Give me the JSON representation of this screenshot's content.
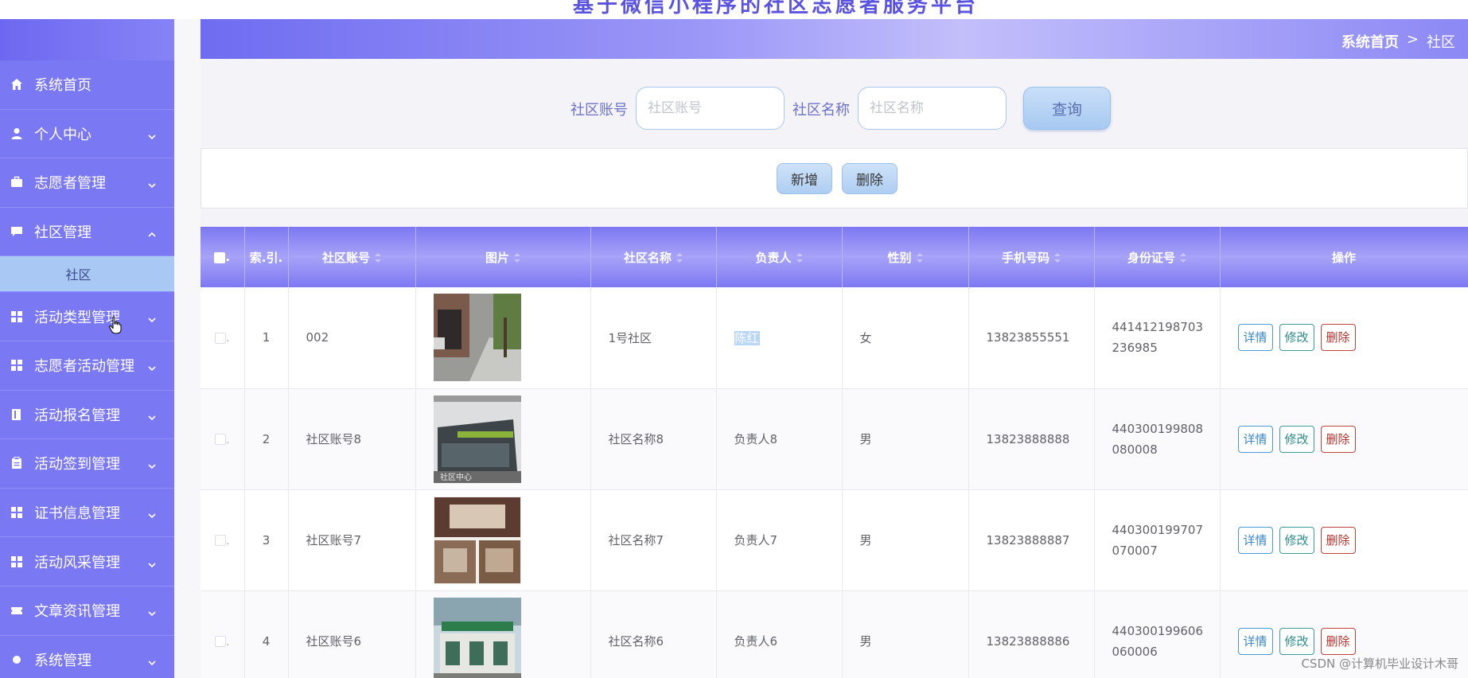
{
  "app": {
    "title": "基于微信小程序的社区志愿者服务平台"
  },
  "breadcrumb": {
    "home": "系统首页",
    "separator": ">",
    "current": "社区"
  },
  "sidebar": {
    "items": [
      {
        "label": "系统首页",
        "icon": "home-icon",
        "expandable": false
      },
      {
        "label": "个人中心",
        "icon": "user-icon",
        "expandable": true
      },
      {
        "label": "志愿者管理",
        "icon": "briefcase-icon",
        "expandable": true
      },
      {
        "label": "社区管理",
        "icon": "chat-icon",
        "expandable": true,
        "expanded": true
      },
      {
        "label": "活动类型管理",
        "icon": "grid-icon",
        "expandable": true
      },
      {
        "label": "志愿者活动管理",
        "icon": "grid-icon",
        "expandable": true
      },
      {
        "label": "活动报名管理",
        "icon": "book-icon",
        "expandable": true
      },
      {
        "label": "活动签到管理",
        "icon": "clipboard-icon",
        "expandable": true
      },
      {
        "label": "证书信息管理",
        "icon": "grid-icon",
        "expandable": true
      },
      {
        "label": "活动风采管理",
        "icon": "grid-icon",
        "expandable": true
      },
      {
        "label": "文章资讯管理",
        "icon": "ticket-icon",
        "expandable": true
      },
      {
        "label": "系统管理",
        "icon": "gear-icon",
        "expandable": true
      }
    ],
    "subitems": {
      "community": [
        {
          "label": "社区"
        }
      ]
    }
  },
  "search": {
    "account_label": "社区账号",
    "account_placeholder": "社区账号",
    "name_label": "社区名称",
    "name_placeholder": "社区名称",
    "query_button": "查询"
  },
  "actions": {
    "add": "新增",
    "delete": "删除"
  },
  "table": {
    "headers": {
      "select": ".",
      "index": "索.引.",
      "account": "社区账号",
      "image": "图片",
      "name": "社区名称",
      "manager": "负责人",
      "gender": "性别",
      "phone": "手机号码",
      "idcard": "身份证号",
      "ops": "操作"
    },
    "rows": [
      {
        "index": "1",
        "account": "002",
        "image": "street-photo",
        "name": "1号社区",
        "manager": "陈红",
        "gender": "女",
        "phone": "13823855551",
        "idcard_a": "441412198703",
        "idcard_b": "236985"
      },
      {
        "index": "2",
        "account": "社区账号8",
        "image": "building-photo",
        "name": "社区名称8",
        "manager": "负责人8",
        "gender": "男",
        "phone": "13823888888",
        "idcard_a": "440300199808",
        "idcard_b": "080008"
      },
      {
        "index": "3",
        "account": "社区账号7",
        "image": "hallway-photo",
        "name": "社区名称7",
        "manager": "负责人7",
        "gender": "男",
        "phone": "13823888887",
        "idcard_a": "440300199707",
        "idcard_b": "070007"
      },
      {
        "index": "4",
        "account": "社区账号6",
        "image": "center-photo",
        "name": "社区名称6",
        "manager": "负责人6",
        "gender": "男",
        "phone": "13823888886",
        "idcard_a": "440300199606",
        "idcard_b": "060006"
      }
    ],
    "row_buttons": {
      "detail": "详情",
      "edit": "修改",
      "delete": "删除"
    },
    "image2_caption": "社区中心"
  },
  "watermark": "CSDN @计算机毕业设计木哥",
  "colors": {
    "sidebar": "#7b78f3",
    "header_gradient_start": "#6f6cf1",
    "accent_button": "#a7c9f1",
    "delete_red": "#c0403a"
  }
}
